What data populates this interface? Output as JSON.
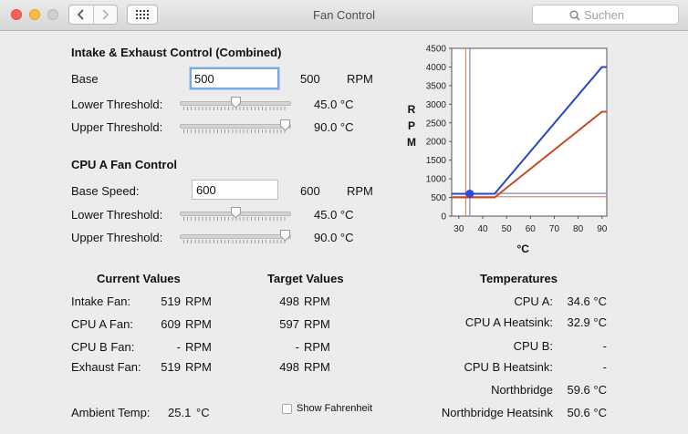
{
  "window": {
    "title": "Fan Control"
  },
  "search": {
    "placeholder": "Suchen"
  },
  "intake": {
    "header": "Intake & Exhaust Control (Combined)",
    "base_label": "Base",
    "base_input": "500",
    "base_value": "500",
    "base_unit": "RPM",
    "lower_label": "Lower Threshold:",
    "lower_value": "45.0 °C",
    "lower_fraction": 0.5,
    "upper_label": "Upper Threshold:",
    "upper_value": "90.0 °C",
    "upper_fraction": 1.0
  },
  "cpu": {
    "header": "CPU A Fan Control",
    "base_label": "Base Speed:",
    "base_input": "600",
    "base_value": "600",
    "base_unit": "RPM",
    "lower_label": "Lower Threshold:",
    "lower_value": "45.0 °C",
    "lower_fraction": 0.5,
    "upper_label": "Upper Threshold:",
    "upper_value": "90.0 °C",
    "upper_fraction": 1.0
  },
  "chart_data": {
    "type": "line",
    "ylabel": "RPM",
    "xlabel": "°C",
    "xlim": [
      27,
      92
    ],
    "ylim": [
      0,
      4500
    ],
    "x_ticks": [
      "30",
      "40",
      "50",
      "60",
      "70",
      "80",
      "90"
    ],
    "y_ticks": [
      "0",
      "500",
      "1000",
      "1500",
      "2000",
      "2500",
      "3000",
      "3500",
      "4000",
      "4500"
    ],
    "grid": false,
    "series": [
      {
        "color": "#2945c8",
        "x": [
          27,
          45,
          90,
          92
        ],
        "y": [
          600,
          600,
          4000,
          4000
        ]
      },
      {
        "color": "#cc4a22",
        "x": [
          27,
          45,
          90,
          92
        ],
        "y": [
          500,
          500,
          2800,
          2800
        ]
      }
    ],
    "crosshair_lines": [
      {
        "color": "#7a86cc",
        "x": 34.6,
        "y": 609
      },
      {
        "color": "#d98a6c",
        "x": 32.9,
        "y": 519
      }
    ],
    "marker": {
      "x": 34.6,
      "y": 600,
      "color": "#2a4bdd"
    }
  },
  "current": {
    "header": "Current Values",
    "rows": [
      {
        "label": "Intake Fan:",
        "value": "519",
        "unit": "RPM"
      },
      {
        "label": "CPU A Fan:",
        "value": "609",
        "unit": "RPM"
      },
      {
        "label": "CPU B Fan:",
        "value": "-",
        "unit": "RPM"
      },
      {
        "label": "Exhaust Fan:",
        "value": "519",
        "unit": "RPM"
      }
    ]
  },
  "target": {
    "header": "Target Values",
    "rows": [
      {
        "value": "498",
        "unit": "RPM"
      },
      {
        "value": "597",
        "unit": "RPM"
      },
      {
        "value": "-",
        "unit": "RPM"
      },
      {
        "value": "498",
        "unit": "RPM"
      }
    ]
  },
  "temps": {
    "header": "Temperatures",
    "rows": [
      {
        "label": "CPU A:",
        "value": "34.6 °C"
      },
      {
        "label": "CPU A Heatsink:",
        "value": "32.9 °C"
      },
      {
        "label": "CPU B:",
        "value": "-"
      },
      {
        "label": "CPU B Heatsink:",
        "value": "-"
      },
      {
        "label": "Northbridge",
        "value": "59.6 °C"
      },
      {
        "label": "Northbridge Heatsink",
        "value": "50.6 °C"
      }
    ]
  },
  "ambient": {
    "label": "Ambient Temp:",
    "value": "25.1",
    "unit": "°C"
  },
  "fahrenheit": {
    "label": "Show Fahrenheit",
    "checked": false
  }
}
